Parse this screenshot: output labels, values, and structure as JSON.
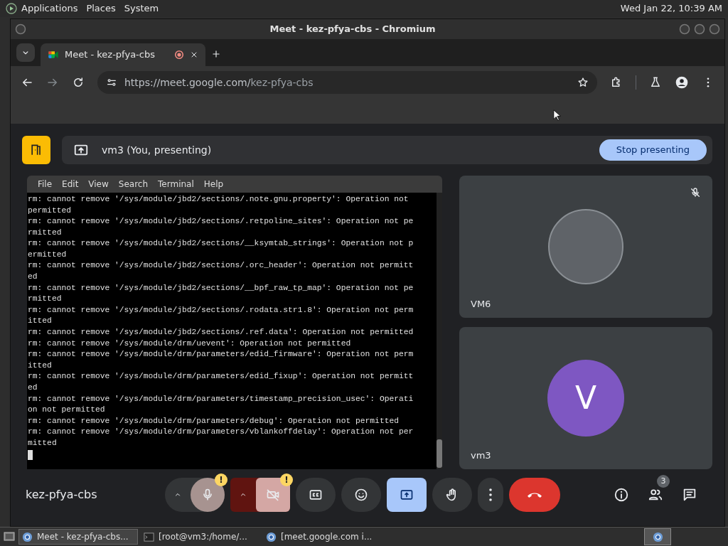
{
  "top_panel": {
    "menus": [
      "Applications",
      "Places",
      "System"
    ],
    "clock": "Wed Jan 22, 10:39 AM"
  },
  "window": {
    "title": "Meet - kez-pfya-cbs - Chromium"
  },
  "tabs": [
    {
      "label": "Meet - kez-pfya-cbs",
      "selected": true,
      "recording": true
    }
  ],
  "toolbar": {
    "url_host": "https://meet.google.com/",
    "url_path": "kez-pfya-cbs"
  },
  "presenting_bar": {
    "label": "vm3 (You, presenting)",
    "button": "Stop presenting"
  },
  "terminal": {
    "menu": [
      "File",
      "Edit",
      "View",
      "Search",
      "Terminal",
      "Help"
    ],
    "lines": [
      "rm: cannot remove '/sys/module/jbd2/sections/.note.gnu.property': Operation not ",
      "permitted",
      "rm: cannot remove '/sys/module/jbd2/sections/.retpoline_sites': Operation not pe",
      "rmitted",
      "rm: cannot remove '/sys/module/jbd2/sections/__ksymtab_strings': Operation not p",
      "ermitted",
      "rm: cannot remove '/sys/module/jbd2/sections/.orc_header': Operation not permitt",
      "ed",
      "rm: cannot remove '/sys/module/jbd2/sections/__bpf_raw_tp_map': Operation not pe",
      "rmitted",
      "rm: cannot remove '/sys/module/jbd2/sections/.rodata.str1.8': Operation not perm",
      "itted",
      "rm: cannot remove '/sys/module/jbd2/sections/.ref.data': Operation not permitted",
      "rm: cannot remove '/sys/module/drm/uevent': Operation not permitted",
      "rm: cannot remove '/sys/module/drm/parameters/edid_firmware': Operation not perm",
      "itted",
      "rm: cannot remove '/sys/module/drm/parameters/edid_fixup': Operation not permitt",
      "ed",
      "rm: cannot remove '/sys/module/drm/parameters/timestamp_precision_usec': Operati",
      "on not permitted",
      "rm: cannot remove '/sys/module/drm/parameters/debug': Operation not permitted",
      "rm: cannot remove '/sys/module/drm/parameters/vblankoffdelay': Operation not per",
      "mitted"
    ]
  },
  "participants": [
    {
      "name": "VM6",
      "muted": true,
      "kind": "blank"
    },
    {
      "name": "vm3",
      "muted": false,
      "kind": "initial",
      "initial": "V",
      "color": "#7e57c2"
    }
  ],
  "bottom_bar": {
    "meeting_code": "kez-pfya-cbs",
    "controls": [
      {
        "kind": "mic",
        "on": true,
        "warning": "!"
      },
      {
        "kind": "camera",
        "on": false,
        "warning": "!"
      },
      {
        "kind": "captions",
        "on": false
      },
      {
        "kind": "emoji",
        "on": false
      },
      {
        "kind": "present",
        "on": true
      },
      {
        "kind": "hand",
        "on": false
      },
      {
        "kind": "more"
      },
      {
        "kind": "leave"
      }
    ],
    "side": [
      {
        "kind": "info"
      },
      {
        "kind": "people",
        "badge": "3"
      },
      {
        "kind": "chat"
      }
    ]
  },
  "taskbar": [
    {
      "label": "Meet - kez-pfya-cbs...",
      "kind": "browser",
      "selected": true
    },
    {
      "label": "[root@vm3:/home/...",
      "kind": "terminal",
      "selected": false
    },
    {
      "label": "[meet.google.com i...",
      "kind": "browser",
      "selected": false
    }
  ]
}
